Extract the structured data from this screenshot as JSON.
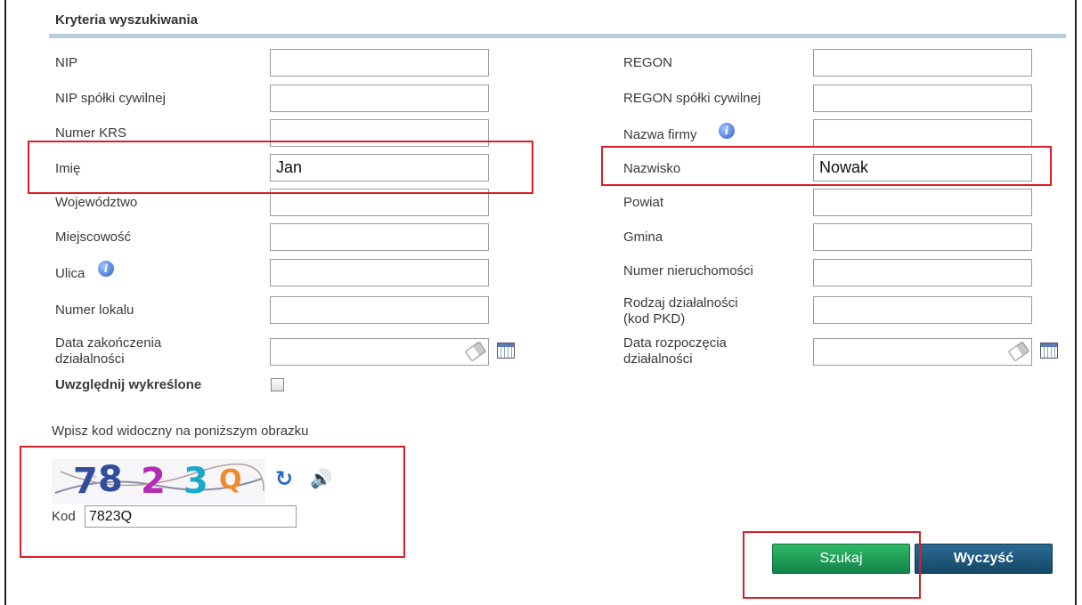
{
  "section_title": "Kryteria wyszukiwania",
  "left_fields": [
    {
      "label": "NIP",
      "value": ""
    },
    {
      "label": "NIP spółki cywilnej",
      "value": ""
    },
    {
      "label": "Numer KRS",
      "value": ""
    },
    {
      "label": "Imię",
      "value": "Jan"
    },
    {
      "label": "Województwo",
      "value": ""
    },
    {
      "label": "Miejscowość",
      "value": ""
    },
    {
      "label": "Ulica",
      "value": ""
    },
    {
      "label": "Numer lokalu",
      "value": ""
    },
    {
      "label_line1": "Data zakończenia",
      "label_line2": "działalności",
      "value": ""
    }
  ],
  "right_fields": [
    {
      "label": "REGON",
      "value": ""
    },
    {
      "label": "REGON spółki cywilnej",
      "value": ""
    },
    {
      "label": "Nazwa firmy",
      "value": ""
    },
    {
      "label": "Nazwisko",
      "value": "Nowak"
    },
    {
      "label": "Powiat",
      "value": ""
    },
    {
      "label": "Gmina",
      "value": ""
    },
    {
      "label": "Numer nieruchomości",
      "value": ""
    },
    {
      "label_line1": "Rodzaj działalności",
      "label_line2": "(kod PKD)",
      "value": ""
    },
    {
      "label_line1": "Data rozpoczęcia",
      "label_line2": "działalności",
      "value": ""
    }
  ],
  "include_deleted": {
    "label": "Uwzględnij wykreślone",
    "checked": false
  },
  "captcha": {
    "instruction": "Wpisz kod widoczny na poniższym obrazku",
    "image_text": "7823Q",
    "code_label": "Kod",
    "code_value": "7823Q"
  },
  "buttons": {
    "search": "Szukaj",
    "clear": "Wyczyść"
  },
  "icons": {
    "info": "info-icon",
    "eraser": "eraser-icon",
    "calendar": "calendar-icon",
    "refresh": "refresh-icon",
    "audio": "speaker-icon"
  },
  "colors": {
    "highlight_box": "#d81f26",
    "search_button": "#1f9e57",
    "clear_button": "#1d5a80",
    "section_rule": "#b8cedb"
  }
}
